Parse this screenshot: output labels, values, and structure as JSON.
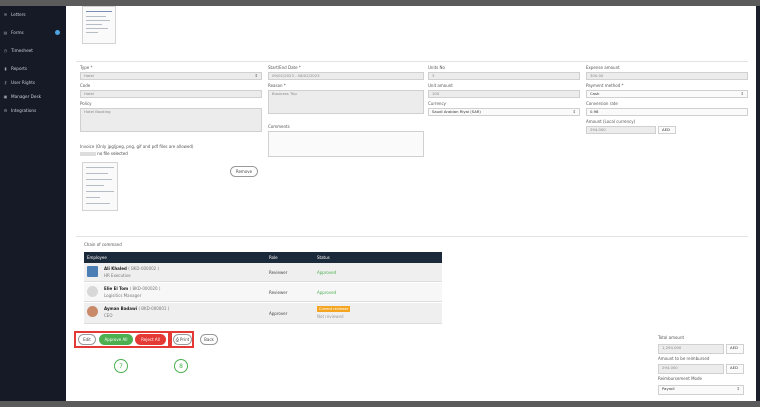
{
  "sidebar": {
    "items": [
      {
        "label": "Letters",
        "icon": "envelope-icon"
      },
      {
        "label": "Forms",
        "icon": "document-icon"
      },
      {
        "label": "Timesheet",
        "icon": "clock-icon"
      },
      {
        "label": "Reports",
        "icon": "chart-icon"
      },
      {
        "label": "User Rights",
        "icon": "key-icon"
      },
      {
        "label": "Manager Desk",
        "icon": "briefcase-icon"
      },
      {
        "label": "Integrations",
        "icon": "plug-icon"
      }
    ]
  },
  "form": {
    "type_label": "Type *",
    "type_value": "Hotel",
    "code_label": "Code",
    "code_value": "Hotel",
    "policy_label": "Policy",
    "policy_value": "Hotel Booking",
    "invoice_label": "Invoice (Only jpg/jpeg, png, gif and pdf files are allowed)",
    "file_status": "no file selected",
    "remove_label": "Remove",
    "dates_label": "Start/End Date *",
    "dates_value": "09/02/2023 - 08/02/2023",
    "reason_label": "Reason *",
    "reason_value": "Business Trip",
    "comments_label": "Comments",
    "units_label": "Units No",
    "units_value": "3",
    "unit_amount_label": "Unit amount",
    "unit_amount_value": "100",
    "currency_label": "Currency",
    "currency_value": "Saudi Arabian Riyal (SAR)",
    "expense_label": "Expense amount",
    "expense_value": "300.00",
    "payment_label": "Payment method *",
    "payment_value": "Cash",
    "conversion_label": "Conversion rate",
    "conversion_value": "0.98",
    "local_amount_label": "Amount (Local currency)",
    "local_amount_value": "294.000",
    "local_currency": "AED"
  },
  "chain": {
    "title": "Chain of command",
    "headers": [
      "Employee",
      "Role",
      "Status"
    ],
    "rows": [
      {
        "name": "Ali Khaled",
        "code": "( BKD-000002 )",
        "title": "HR Executive",
        "role": "Reviewer",
        "status": "Approved",
        "current": ""
      },
      {
        "name": "Elie El Tom",
        "code": "( BKD-000020 )",
        "title": "Logisitics Manager",
        "role": "Reviewer",
        "status": "Approved",
        "current": ""
      },
      {
        "name": "Ayman Badawi",
        "code": "( BKD-000001 )",
        "title": "CEO",
        "role": "Approver",
        "status": "Not reviewed",
        "current": "Current reviewer"
      }
    ]
  },
  "actions": {
    "edit": "Edit",
    "approve_all": "Approve All",
    "reject_all": "Reject All",
    "print": "Print",
    "back": "Back",
    "step7": "7",
    "step8": "8"
  },
  "totals": {
    "total_label": "Total amount",
    "total_value": "1,294.000",
    "total_currency": "AED",
    "reimburse_label": "Amount to be reimbursed",
    "reimburse_value": "294.000",
    "reimburse_currency": "AED",
    "mode_label": "Reimbursement Mode",
    "mode_value": "Payroll"
  },
  "colors": {
    "sidebar": "#151a26",
    "approve": "#4caf50",
    "reject": "#e53935",
    "highlight": "#e53935",
    "current_reviewer": "#f4a623"
  }
}
